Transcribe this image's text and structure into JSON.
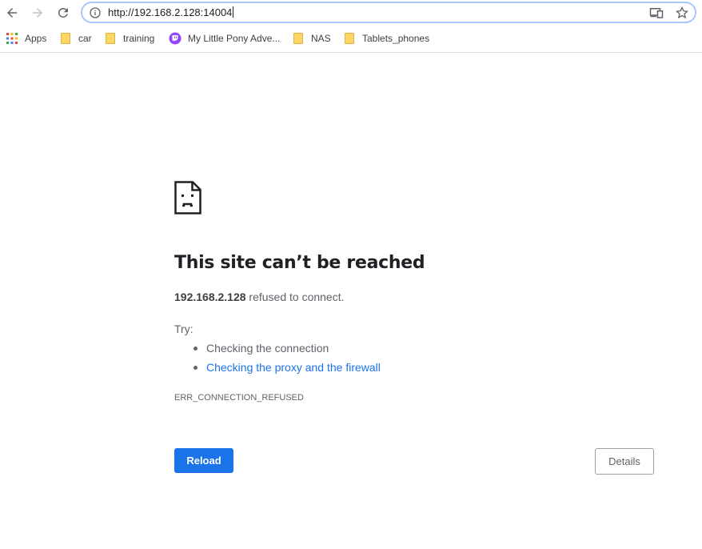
{
  "toolbar": {
    "url": "http://192.168.2.128:14004"
  },
  "bookmarks": [
    {
      "label": "Apps",
      "icon": "apps-grid-icon"
    },
    {
      "label": "car",
      "icon": "folder-icon"
    },
    {
      "label": "training",
      "icon": "folder-icon"
    },
    {
      "label": "My Little Pony Adve...",
      "icon": "twitch-icon"
    },
    {
      "label": "NAS",
      "icon": "folder-icon"
    },
    {
      "label": "Tablets_phones",
      "icon": "folder-icon"
    }
  ],
  "error": {
    "title": "This site can’t be reached",
    "host": "192.168.2.128",
    "message": "refused to connect.",
    "try_label": "Try:",
    "suggestions": [
      "Checking the connection",
      "Checking the proxy and the firewall"
    ],
    "code": "ERR_CONNECTION_REFUSED",
    "reload_label": "Reload",
    "details_label": "Details"
  },
  "colors": {
    "accent": "#1a73e8",
    "folder": "#fcd667",
    "twitch": "#9146ff"
  }
}
